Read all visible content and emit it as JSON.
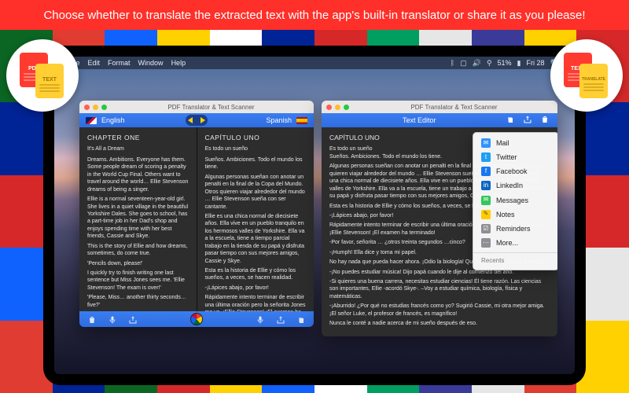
{
  "promo": {
    "text": "Choose whether to translate the extracted text with the app's built-in translator or share it as you please!"
  },
  "menubar": {
    "items": [
      "File",
      "Edit",
      "Format",
      "Window",
      "Help"
    ],
    "battery": "51%",
    "day": "Fri 28"
  },
  "translator_window": {
    "title": "PDF Translator & Text Scanner",
    "source_lang": "English",
    "target_lang": "Spanish",
    "source": {
      "chapter": "CHAPTER ONE",
      "subtitle": "It's All a Dream",
      "paragraphs": [
        "Dreams. Ambitions. Everyone has them. Some people dream of scoring a penalty in the World Cup Final. Others want to travel around the world… Ellie Stevenson dreams of being a singer.",
        "Ellie is a normal seventeen-year-old girl. She lives in a quiet village in the beautiful Yorkshire Dales. She goes to school, has a part-time job in her Dad's shop and enjoys spending time with her best friends, Cassie and Skye.",
        "This is the story of Ellie and how dreams, sometimes, do come true.",
        "'Pencils down, please!'",
        "I quickly try to finish writing one last sentence but Miss Jones sees me. 'Ellie Stevenson! The exam is over!'",
        "'Please, Miss… another thirty seconds… five?'"
      ]
    },
    "target": {
      "chapter": "CAPÍTULO UNO",
      "subtitle": "Es todo un sueño",
      "paragraphs": [
        "Sueños. Ambiciones. Todo el mundo los tiene.",
        "Algunas personas sueñan con anotar un penalti en la final de la Copa del Mundo. Otros quieren viajar alrededor del mundo … Ellie Stevenson sueña con ser cantante.",
        "Ellie es una chica normal de diecisiete años. Ella vive en un pueblo tranquilo en los hermosos valles de Yorkshire. Ella va a la escuela, tiene a tiempo parcial trabajo en la tienda de su papá y disfruta pasar tiempo con sus mejores amigos, Cassie y Skye.",
        "Esta es la historia de Ellie y cómo los sueños, a veces, se hacen realidad.",
        "-¡Lápices abajo, por favor!",
        "Rápidamente intento terminar de escribir una última oración pero la señorita Jones me ve. ¡Ellie Stevenson! ¡El examen ha ter-"
      ]
    }
  },
  "editor_window": {
    "title": "PDF Translator & Text Scanner",
    "header": "Text Editor",
    "chapter": "CAPÍTULO UNO",
    "subtitle": "Es todo un sueño",
    "paragraphs": [
      "Sueños. Ambiciones. Todo el mundo los tiene.",
      "Algunas personas sueñan con anotar un penalti en la final de la Copa del Mundo. Otros quieren viajar alrededor del mundo … Ellie Stevenson sueña con ser cantante. Ellie es una chica normal de diecisiete años. Ella vive en un pueblo tranquilo en los hermosos valles de Yorkshire. Ella va a la escuela, tiene un trabajo a tiempo parcial en la tienda de su papá y disfruta pasar tiempo con sus mejores amigos, Cassie y Skye.",
      "Esta es la historia de Ellie y cómo los sueños, a veces, se hacen realidad.",
      "-¡Lápices abajo, por favor!",
      "Rápidamente intento terminar de escribir una última oración pero la señorita Jones me ve. ¡Ellie Stevenson! ¡El examen ha terminado!",
      "-Por favor, señorita … ¿otros treinta segundos …cinco?",
      "-¡Humph! Ella dice y toma mi papel.",
      "No hay nada que pueda hacer ahora. ¡Odio la biología! Quiero estudiar música a nivel A.",
      "-¡No puedes estudiar música! Dijo papá cuando le dije al comienzo del año.",
      "-Si quieres una buena carrera, necesitas estudiar ciencias! Él tiene razón. Las ciencias son importantes, Ellie -acordó Skye-. –Voy a estudiar química, biología, física y matemáticas.",
      "-¡Aburrido! ¿Por qué no estudias francés como yo? Sugirió Cassie, mi otra mejor amiga. ¡El señor Luke, el profesor de francés, es magnífico!",
      "Nunca le conté a nadie acerca de mi sueño después de eso."
    ]
  },
  "share_menu": {
    "items": [
      {
        "label": "Mail"
      },
      {
        "label": "Twitter"
      },
      {
        "label": "Facebook"
      },
      {
        "label": "LinkedIn"
      },
      {
        "label": "Messages"
      },
      {
        "label": "Notes"
      },
      {
        "label": "Reminders"
      },
      {
        "label": "More..."
      }
    ],
    "recents_header": "Recents"
  },
  "badges": {
    "left": {
      "doc1": "PDF",
      "doc2": "TEXT"
    },
    "right": {
      "doc1": "TEXT",
      "doc2": "TRANSLATE"
    }
  }
}
